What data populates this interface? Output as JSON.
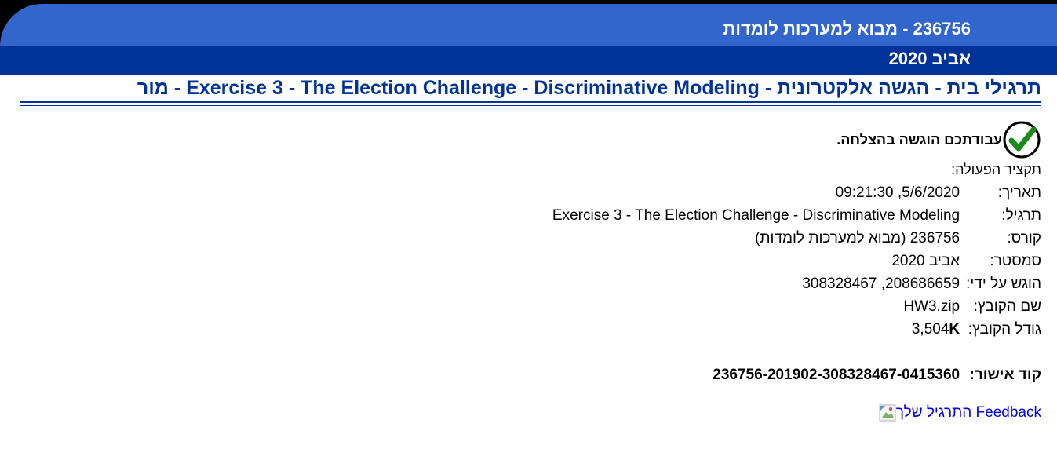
{
  "header": {
    "course_title": "236756 - מבוא למערכות לומדות",
    "semester": "אביב 2020"
  },
  "page_title": "תרגילי בית - הגשה אלקטרונית - Exercise 3 - The Election Challenge - Discriminative Modeling - מור",
  "status": {
    "success_icon": "checkmark-circle-icon",
    "success_message": "עבודתכם הוגשה בהצלחה.",
    "summary_label": "תקציר הפעולה:"
  },
  "details": {
    "date_label": "תאריך:",
    "date_value": "5/6/2020, 09:21:30",
    "exercise_label": "תרגיל:",
    "exercise_value": "Exercise 3 - The Election Challenge - Discriminative Modeling",
    "course_label": "קורס:",
    "course_value": "236756 (מבוא למערכות לומדות)",
    "semester_label": "סמסטר:",
    "semester_value": "אביב 2020",
    "submitted_by_label": "הוגש על ידי:",
    "submitted_by_value": "208686659, 308328467",
    "filename_label": "שם הקובץ:",
    "filename_value": "HW3.zip",
    "filesize_label": "גודל הקובץ:",
    "filesize_value": "3,504",
    "filesize_unit": "K",
    "approval_label": "קוד אישור:",
    "approval_value": "236756-201902-308328467-0415360"
  },
  "feedback": {
    "link_text": "Feedback התרגיל שלך",
    "icon": "broken-image-icon"
  },
  "colors": {
    "header_light": "#3366cc",
    "header_dark": "#003399",
    "title_blue": "#003399",
    "link": "#0000ee",
    "check_green": "#1a8a1a"
  }
}
